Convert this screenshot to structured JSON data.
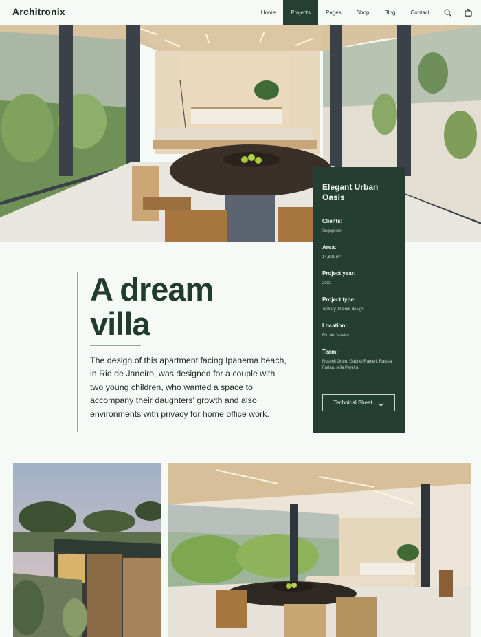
{
  "header": {
    "logo": "Architronix",
    "nav": [
      {
        "label": "Home",
        "active": false
      },
      {
        "label": "Projects",
        "active": true
      },
      {
        "label": "Pages",
        "active": false
      },
      {
        "label": "Shop",
        "active": false
      },
      {
        "label": "Blog",
        "active": false
      },
      {
        "label": "Contact",
        "active": false
      }
    ],
    "icons": [
      "search-icon",
      "shopping-bag-icon"
    ]
  },
  "project_card": {
    "title": "Elegant Urban Oasis",
    "details": [
      {
        "label": "Clients:",
        "value": "Sogeprom"
      },
      {
        "label": "Area:",
        "value": "14,891 m²"
      },
      {
        "label": "Project year:",
        "value": "2022"
      },
      {
        "label": "Project type:",
        "value": "Tertiary, Interior design"
      },
      {
        "label": "Location:",
        "value": "Rio de Janeiro"
      },
      {
        "label": "Team:",
        "value": "Russell Otten, Gabriel Ranieri, Raissa Furlan, Mila Pereira"
      }
    ],
    "button_label": "Technical Sheet",
    "button_icon": "arrow-down-icon"
  },
  "intro": {
    "headline_line1": "A dream",
    "headline_line2": "villa",
    "body": "The design of this apartment facing Ipanema beach, in Rio de Janeiro, was designed for a couple with two young children, who wanted a space to accompany their daughters' growth and also environments with privacy for home office work."
  },
  "colors": {
    "accent": "#243f32",
    "background": "#f6faf6",
    "text": "#222b25"
  }
}
